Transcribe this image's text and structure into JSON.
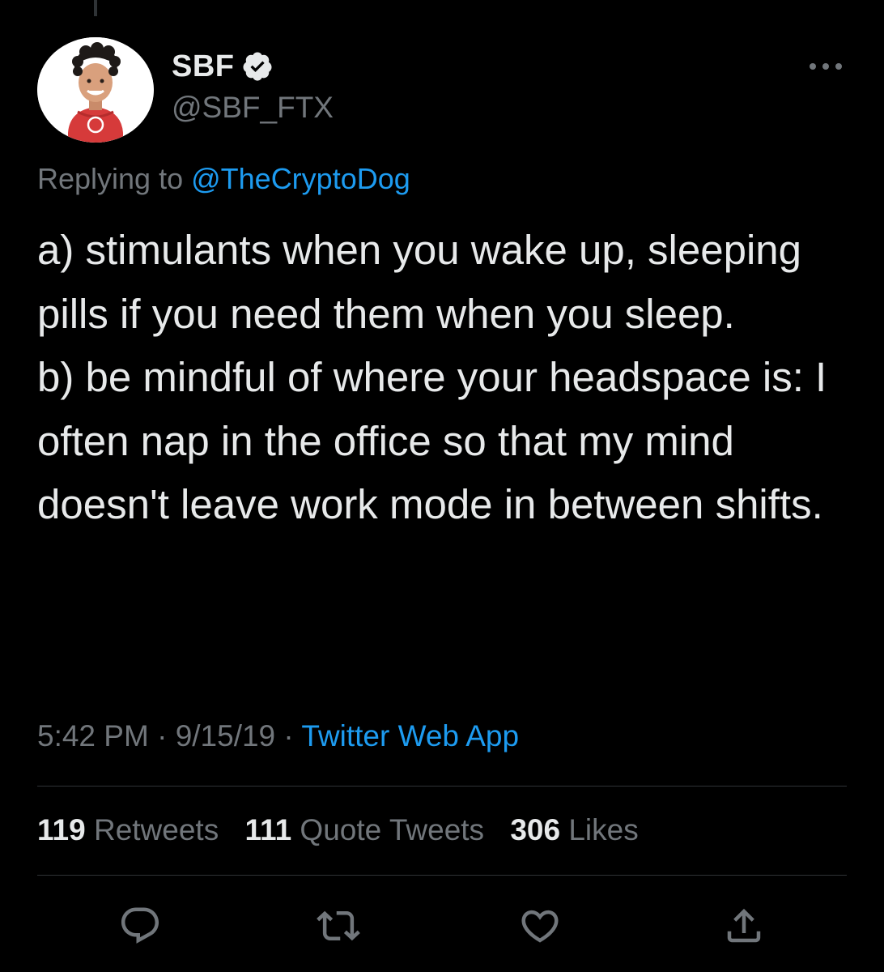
{
  "colors": {
    "background": "#000000",
    "text": "#e7e9ea",
    "secondary_text": "#71767b",
    "accent": "#1d9bf0",
    "divider": "#2f3336"
  },
  "author": {
    "display_name": "SBF",
    "handle": "@SBF_FTX",
    "verified_icon": "verified-badge-icon",
    "avatar_icon": "profile-avatar"
  },
  "reply": {
    "prefix": "Replying to ",
    "mention": "@TheCryptoDog"
  },
  "tweet": {
    "text": "a) stimulants when you wake up, sleeping pills if you need them when you sleep.\nb) be mindful of where your headspace is: I often nap in the office so that my mind doesn't leave work mode in between shifts."
  },
  "meta": {
    "time": "5:42 PM",
    "separator": " · ",
    "date": "9/15/19",
    "source": "Twitter Web App"
  },
  "stats": {
    "retweets_count": "119",
    "retweets_label": " Retweets",
    "quotes_count": "111",
    "quotes_label": " Quote Tweets",
    "likes_count": "306",
    "likes_label": " Likes"
  },
  "actions": [
    {
      "icon": "reply-icon"
    },
    {
      "icon": "retweet-icon"
    },
    {
      "icon": "like-icon"
    },
    {
      "icon": "share-icon"
    }
  ],
  "more_icon": "more-options-icon"
}
